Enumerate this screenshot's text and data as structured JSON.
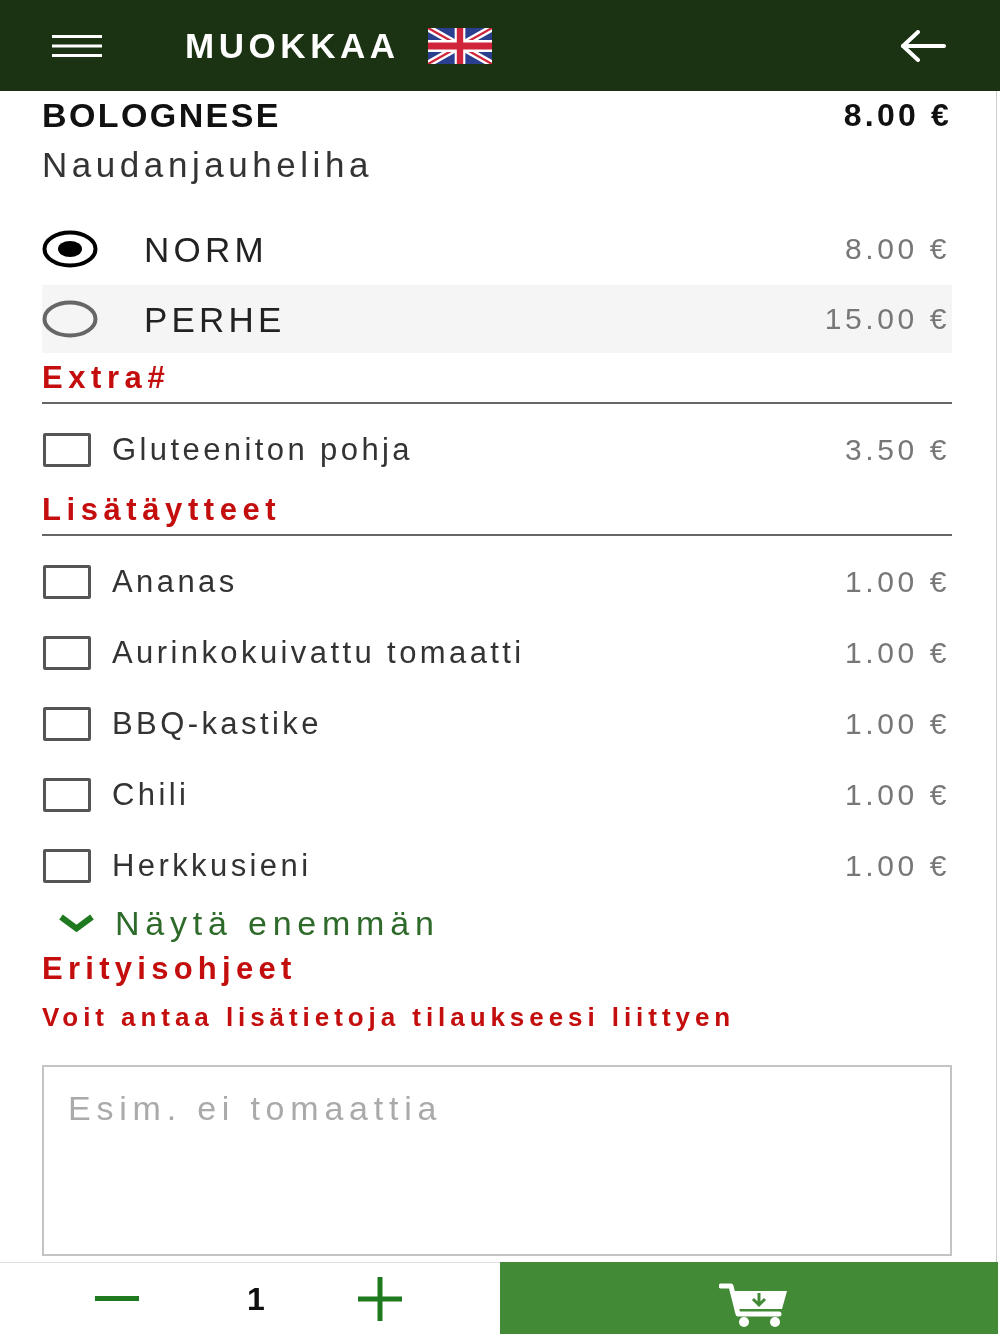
{
  "header": {
    "title": "MUOKKAA"
  },
  "product": {
    "name": "BOLOGNESE",
    "price": "8.00 €",
    "description": "Naudanjauheliha"
  },
  "sizes": [
    {
      "label": "NORM",
      "price": "8.00 €",
      "selected": true
    },
    {
      "label": "PERHE",
      "price": "15.00 €",
      "selected": false
    }
  ],
  "groups": [
    {
      "title": "Extra#",
      "options": [
        {
          "label": "Gluteeniton pohja",
          "price": "3.50 €",
          "checked": false
        }
      ]
    },
    {
      "title": "Lisätäytteet",
      "options": [
        {
          "label": "Ananas",
          "price": "1.00 €",
          "checked": false
        },
        {
          "label": "Aurinkokuivattu tomaatti",
          "price": "1.00 €",
          "checked": false
        },
        {
          "label": "BBQ-kastike",
          "price": "1.00 €",
          "checked": false
        },
        {
          "label": "Chili",
          "price": "1.00 €",
          "checked": false
        },
        {
          "label": "Herkkusieni",
          "price": "1.00 €",
          "checked": false
        }
      ]
    }
  ],
  "show_more": {
    "label": "Näytä enemmän"
  },
  "instructions": {
    "title": "Erityisohjeet",
    "hint": "Voit antaa lisätietoja tilaukseesi liittyen",
    "placeholder": "Esim. ei tomaattia"
  },
  "quantity": {
    "value": "1"
  }
}
